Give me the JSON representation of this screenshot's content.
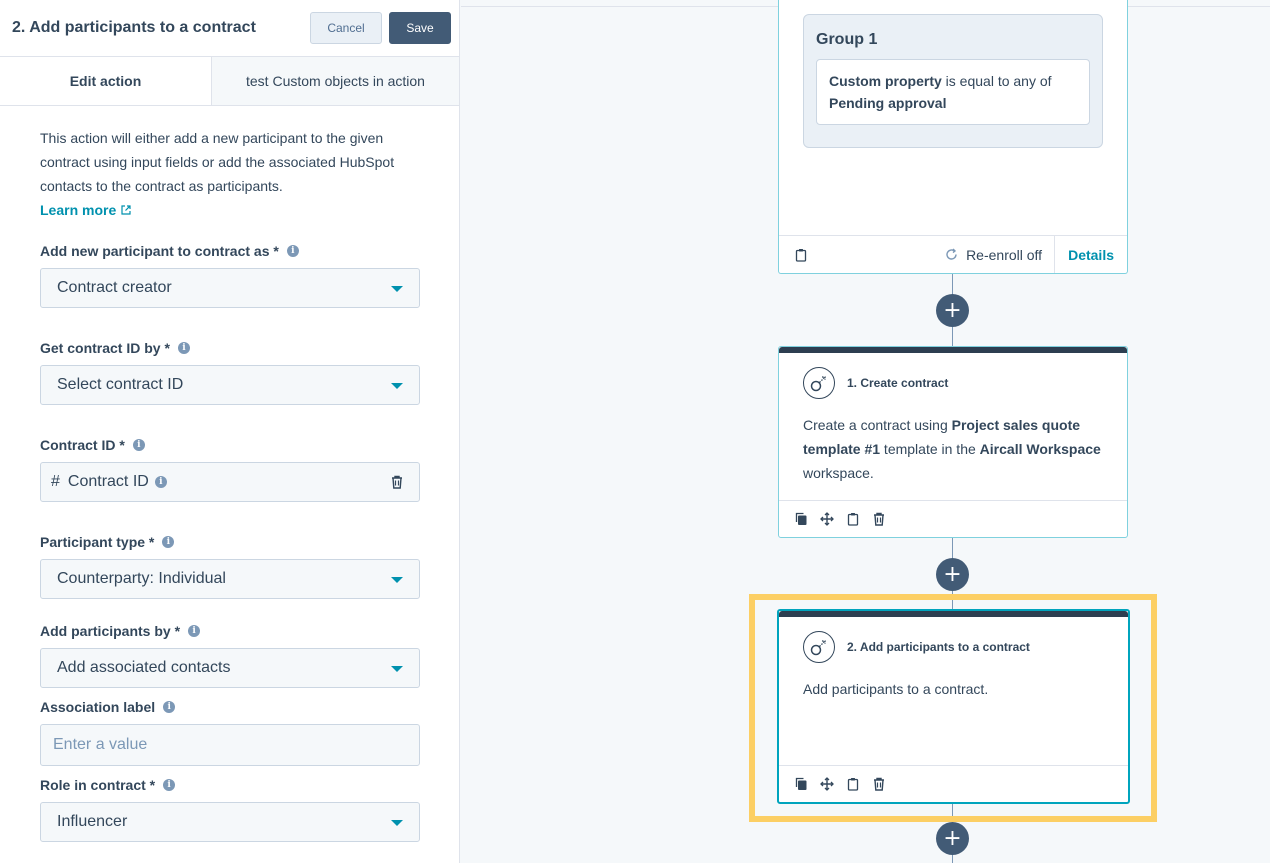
{
  "panel": {
    "title": "2. Add participants to a contract",
    "cancel_label": "Cancel",
    "save_label": "Save",
    "tabs": [
      {
        "label": "Edit action"
      },
      {
        "label": "test Custom objects in action"
      }
    ],
    "description": "This action will either add a new participant to the given contract using input fields or add the associated HubSpot contacts to the contract as participants.",
    "learn_more": "Learn more",
    "fields": {
      "add_as": {
        "label": "Add new participant to contract as *",
        "value": "Contract creator"
      },
      "get_id_by": {
        "label": "Get contract ID by *",
        "value": "Select contract ID"
      },
      "contract_id": {
        "label": "Contract ID *",
        "value": "Contract ID"
      },
      "participant_type": {
        "label": "Participant type *",
        "value": "Counterparty: Individual"
      },
      "add_by": {
        "label": "Add participants by *",
        "value": "Add associated contacts"
      },
      "association_label": {
        "label": "Association label",
        "placeholder": "Enter a value"
      },
      "role": {
        "label": "Role in contract *",
        "value": "Influencer"
      }
    }
  },
  "canvas": {
    "trigger": {
      "group_title": "Group 1",
      "filter_property": "Custom property",
      "filter_operator": " is equal to any of",
      "filter_value": "Pending approval",
      "reenroll": "Re-enroll off",
      "details": "Details"
    },
    "action1": {
      "title": "1. Create contract",
      "body_1": "Create a contract using ",
      "body_2": "Project sales quote template #1",
      "body_3": " template in the ",
      "body_4": "Aircall Workspace",
      "body_5": " workspace."
    },
    "action2": {
      "title": "2. Add participants to a contract",
      "body": "Add participants to a contract."
    },
    "plus_symbol": "+"
  },
  "colors": {
    "accent": "#0091ae",
    "dark": "#425b76",
    "highlight": "#fccf64",
    "card_border_selected": "#00a4bd"
  }
}
